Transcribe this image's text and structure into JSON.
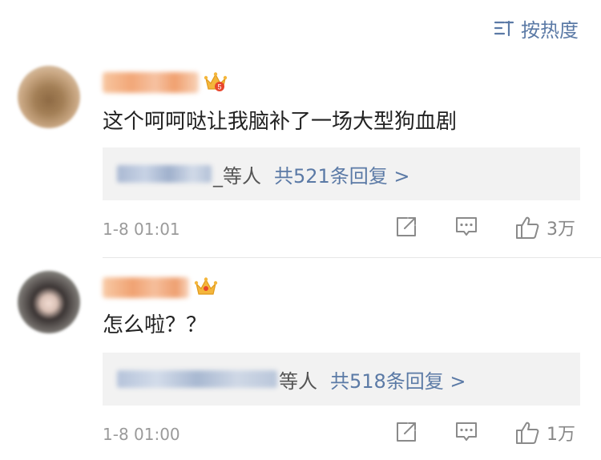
{
  "sort": {
    "label": "按热度",
    "icon": "sort-icon"
  },
  "comments": [
    {
      "avatar": "user-avatar",
      "badge": "crown-icon",
      "text": "这个呵呵哒让我脑补了一场大型狗血剧",
      "reply_who": "_等人",
      "reply_count": "共521条回复 >",
      "time": "1-8 01:01",
      "likes": "3万"
    },
    {
      "avatar": "user-avatar",
      "badge": "crown-icon",
      "text": "怎么啦？？",
      "reply_who": "等人",
      "reply_count": "共518条回复 >",
      "time": "1-8 01:00",
      "likes": "1万"
    }
  ],
  "colors": {
    "link": "#5b7aa6",
    "muted": "#9a9a9a",
    "reply_bg": "#f2f2f2",
    "crown": "#f4b63b"
  }
}
